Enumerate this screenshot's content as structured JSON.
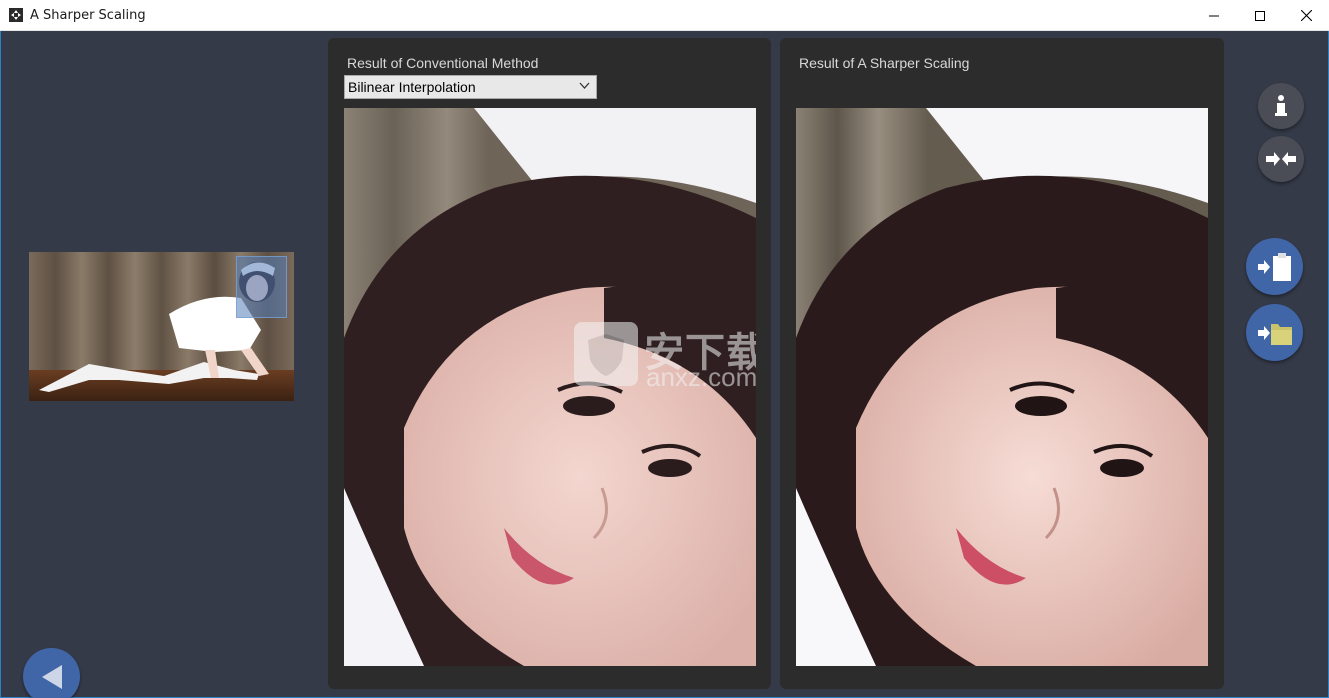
{
  "window": {
    "title": "A Sharper Scaling",
    "controls": [
      "minimize",
      "maximize",
      "close"
    ]
  },
  "panels": {
    "conventional": {
      "title": "Result of Conventional Method",
      "method_select": {
        "selected": "Bilinear Interpolation"
      }
    },
    "sharper": {
      "title": "Result of  A Sharper Scaling"
    }
  },
  "watermark": {
    "cn_text": "安下载",
    "domain_text": "anxz.com"
  },
  "icons": {
    "info": "info-icon",
    "compare": "compare-arrows-icon",
    "paste": "clipboard-icon",
    "open": "folder-icon",
    "back": "back-arrow-icon"
  },
  "colors": {
    "background": "#353a48",
    "panel": "#2c2c2c",
    "accent_button": "#4166a8",
    "grey_button": "#4a4d56"
  }
}
